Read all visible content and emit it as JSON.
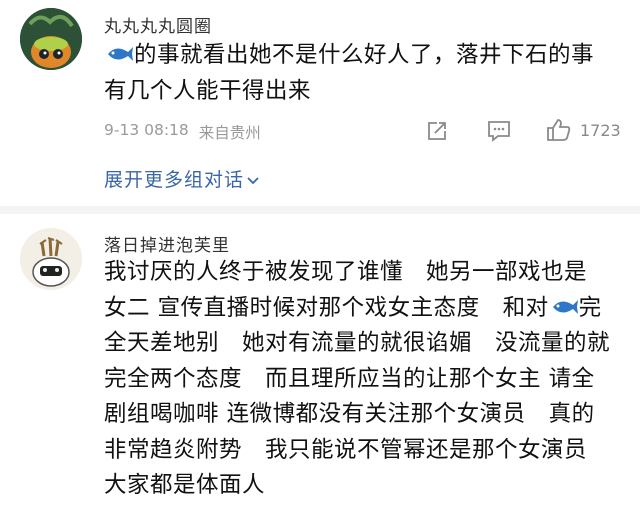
{
  "comments": [
    {
      "username": "丸丸丸丸圆圈",
      "text_line1": "的事就看出她不是什么好人了，落井下石的事",
      "text_line2": "有几个人能干得出来",
      "time": "9-13 08:18",
      "location": "来自贵州",
      "like_count": "1723",
      "expand_label": "展开更多组对话"
    },
    {
      "username": "落日掉进泡芙里",
      "lines": [
        "我讨厌的人终于被发现了谁懂　她另一部戏也是",
        "女二 宣传直播时候对那个戏女主态度　和对",
        "全天差地别　她对有流量的就很谄媚　没流量的就",
        "完全两个态度　而且理所应当的让那个女主 请全",
        "剧组喝咖啡 连微博都没有关注那个女演员　真的",
        "非常趋炎附势　我只能说不管幂还是那个女演员",
        "大家都是体面人"
      ],
      "line2_suffix": "完"
    }
  ],
  "icons": {
    "fish": "fish-emoji-icon",
    "share": "share-icon",
    "comment": "comment-icon",
    "like": "thumbs-up-icon",
    "chevron": "chevron-down-icon"
  },
  "colors": {
    "link": "#3a66a8",
    "meta": "#9a9a9a",
    "divider": "#f4f4f4"
  }
}
